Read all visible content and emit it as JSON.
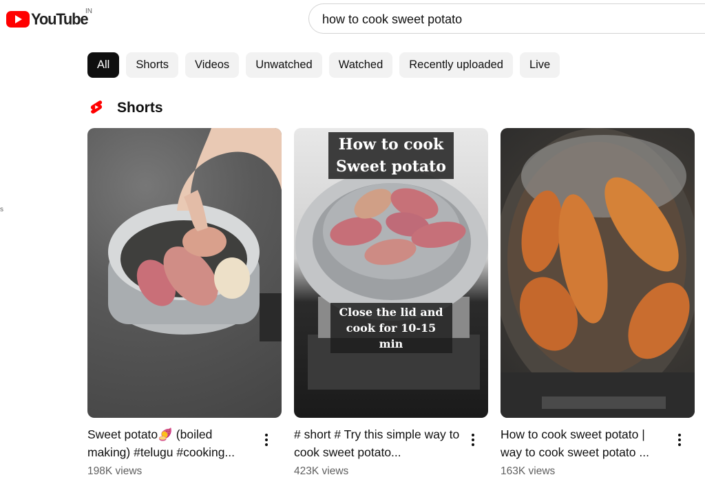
{
  "header": {
    "logo_text": "YouTube",
    "country_code": "IN",
    "search_value": "how to cook sweet potato",
    "edge_text": "s"
  },
  "chips": [
    "All",
    "Shorts",
    "Videos",
    "Unwatched",
    "Watched",
    "Recently uploaded",
    "Live"
  ],
  "shorts": {
    "heading": "Shorts",
    "items": [
      {
        "title": "Sweet potato🍠 (boiled making) #telugu #cooking...",
        "views": "198K views",
        "overlay_top": "",
        "overlay_bottom": ""
      },
      {
        "title": "# short # Try this simple way to cook sweet potato...",
        "views": "423K views",
        "overlay_top": "How to cook Sweet potato",
        "overlay_bottom": "Close the lid and cook for 10-15 min"
      },
      {
        "title": "How to cook sweet potato | way to cook sweet potato ...",
        "views": "163K views",
        "overlay_top": "",
        "overlay_bottom": ""
      }
    ]
  },
  "colors": {
    "brand_red": "#ff0000",
    "chip_bg": "#f2f2f2",
    "chip_active_bg": "#0f0f0f",
    "meta_gray": "#606060"
  }
}
